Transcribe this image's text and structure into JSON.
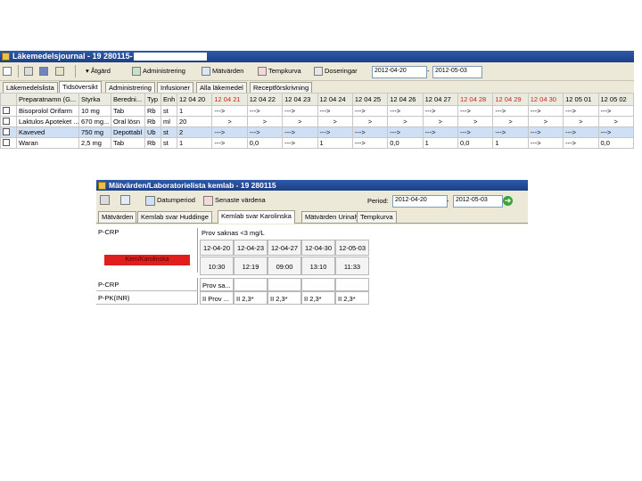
{
  "journal": {
    "title": "Läkemedelsjournal - 19 280115-",
    "toolbar": {
      "atgard": "Åtgärd",
      "administrering": "Administrering",
      "matvarden": "Mätvärden",
      "tempkurva": "Tempkurva",
      "doseringar": "Doseringar",
      "date_from": "2012-04-20",
      "date_to": "2012-05-03"
    },
    "tabs": [
      "Läkemedelslista",
      "Tidsöversikt",
      "Administrering",
      "Infusioner",
      "Alla läkemedel",
      "Receptförskrivning"
    ],
    "columns": [
      "Preparatnamn (G...",
      "Styrka",
      "Beredni...",
      "Typ",
      "Enh",
      "12 04 20",
      "12 04 21",
      "12 04 22",
      "12 04 23",
      "12 04 24",
      "12 04 25",
      "12 04 26",
      "12 04 27",
      "12 04 28",
      "12 04 29",
      "12 04 30",
      "12 05 01",
      "12 05 02"
    ],
    "rows": [
      [
        "Bisoprolol Orifarm",
        "10 mg",
        "Tab",
        "Rb",
        "st",
        "1",
        "--->",
        "--->",
        "--->",
        "--->",
        "--->",
        "--->",
        "--->",
        "--->",
        "--->",
        "--->",
        "--->",
        "--->"
      ],
      [
        "Laktulos Apoteket ...",
        "670 mg...",
        "Oral lösn",
        "Rb",
        "ml",
        "20",
        ">",
        ">",
        ">",
        ">",
        ">",
        ">",
        ">",
        ">",
        ">",
        ">",
        ">",
        ">"
      ],
      [
        "Kaveved",
        "750 mg",
        "Depottabl",
        "Ub",
        "st",
        "2",
        "--->",
        "--->",
        "--->",
        "--->",
        "--->",
        "--->",
        "--->",
        "--->",
        "--->",
        "--->",
        "--->",
        "--->"
      ],
      [
        "Waran",
        "2,5 mg",
        "Tab",
        "Rb",
        "st",
        "1",
        "--->",
        "0,0",
        "--->",
        "1",
        "--->",
        "0,0",
        "1",
        "0,0",
        "1",
        "--->",
        "--->",
        "0,0"
      ]
    ]
  },
  "lab": {
    "title": "Mätvärden/Laboratorielista kemlab - 19 280115",
    "datumperiod": "Datumperiod",
    "senaste": "Senaste värdena",
    "period_label": "Period:",
    "date_from": "2012-04-20",
    "date_to": "2012-05-03",
    "tabs": [
      "Mätvärden",
      "Kemlab svar Huddinge",
      "Kemlab svar Karolinska",
      "Mätvärden Urinalys",
      "Tempkurva"
    ],
    "panel_label": "P-CRP",
    "panel_sub": "Prov saknas",
    "unit": "<3 mg/L",
    "red_label": "Kem/Karolinska",
    "dates": [
      "12-04-20",
      "12-04-23",
      "12-04-27",
      "12-04-30",
      "12-05-03"
    ],
    "times": [
      "10:30",
      "12:19",
      "09:00",
      "13:10",
      "11:33"
    ],
    "rows": [
      {
        "label": "P-CRP",
        "values": [
          "Prov sa...",
          "",
          "",
          "",
          ""
        ]
      },
      {
        "label": "P-PK(INR)",
        "values": [
          "II Prov ...",
          "II 2,3*",
          "II 2,3*",
          "II 2,3*",
          "II 2,3*"
        ]
      }
    ]
  },
  "colors": {
    "title_bar": "#1d3f86",
    "weekend": "#d21d1d",
    "red_button": "#e11e1e",
    "arrow": "#3aa33a"
  }
}
